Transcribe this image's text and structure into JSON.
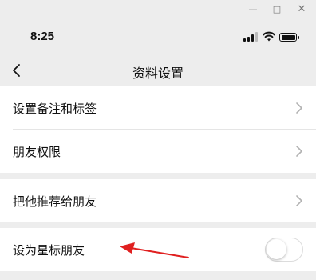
{
  "window": {
    "minimize_glyph": "—",
    "maximize_glyph": "□",
    "close_glyph": "✕"
  },
  "status_bar": {
    "time": "8:25",
    "icons": [
      "signal-icon",
      "wifi-icon",
      "battery-icon"
    ]
  },
  "nav": {
    "title": "资料设置",
    "back_icon": "chevron-left-icon"
  },
  "groups": [
    {
      "items": [
        {
          "label": "设置备注和标签",
          "accessory": "chevron-right-icon"
        },
        {
          "label": "朋友权限",
          "accessory": "chevron-right-icon"
        }
      ]
    },
    {
      "items": [
        {
          "label": "把他推荐给朋友",
          "accessory": "chevron-right-icon"
        }
      ]
    },
    {
      "items": [
        {
          "label": "设为星标朋友",
          "accessory": "toggle",
          "toggle_on": false
        }
      ]
    }
  ],
  "annotation": {
    "type": "arrow",
    "color": "#e02020",
    "points_to": "设为星标朋友"
  },
  "colors": {
    "page_background": "#ededed",
    "row_background": "#ffffff",
    "chevron": "#b2b2b2",
    "divider": "#e5e5e5"
  }
}
